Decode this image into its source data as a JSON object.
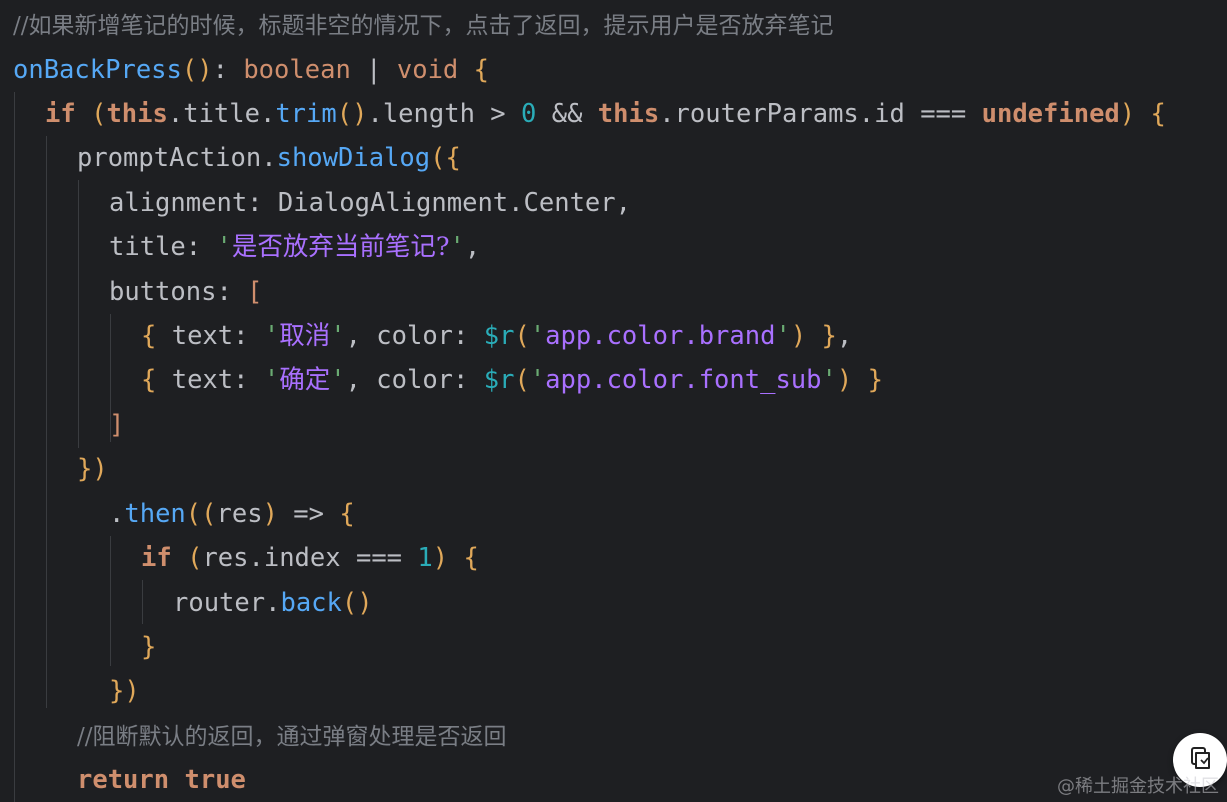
{
  "code": {
    "comment_top": "//如果新增笔记的时候，标题非空的情况下，点击了返回，提示用户是否放弃笔记",
    "l2": {
      "fn": "onBackPress",
      "paren": "()",
      "colon": ": ",
      "t1": "boolean",
      "pipe": " | ",
      "t2": "void",
      "brace": " {"
    },
    "l3": {
      "if": "if",
      "sp": " ",
      "op": "(",
      "this1": "this",
      "p1": ".title.",
      "trim": "trim",
      "call": "()",
      "p2": ".length > ",
      "zero": "0",
      "and": " && ",
      "this2": "this",
      "p3": ".routerParams.id === ",
      "undef": "undefined",
      "cp": ")",
      "ob": " {"
    },
    "l4": {
      "obj": "promptAction.",
      "fn": "showDialog",
      "op": "(",
      "ob": "{"
    },
    "l5": {
      "text": "alignment: DialogAlignment.Center,"
    },
    "l6": {
      "key": "title: ",
      "q1": "'",
      "val": "是否放弃当前笔记?",
      "q2": "'",
      "comma": ","
    },
    "l7": {
      "key": "buttons: ",
      "bracket": "["
    },
    "l8": {
      "ob": "{",
      "k1": " text: ",
      "q1": "'",
      "v1": "取消",
      "q2": "'",
      "c1": ", color: ",
      "dollar": "$r",
      "op": "(",
      "sq1": "'",
      "sv": "app.color.brand",
      "sq2": "'",
      "cp": ")",
      "cb": " }",
      "comma": ","
    },
    "l9": {
      "ob": "{",
      "k1": " text: ",
      "q1": "'",
      "v1": "确定",
      "q2": "'",
      "c1": ", color: ",
      "dollar": "$r",
      "op": "(",
      "sq1": "'",
      "sv": "app.color.font_sub",
      "sq2": "'",
      "cp": ")",
      "cb": " }"
    },
    "l10": {
      "bracket": "]"
    },
    "l11": {
      "cb": "}",
      "cp": ")"
    },
    "l12": {
      "dot": ".",
      "fn": "then",
      "op": "((",
      "param": "res",
      "cp": ")",
      "arrow": " => ",
      "ob": "{"
    },
    "l13": {
      "if": "if",
      "sp": " ",
      "op": "(",
      "expr": "res.index === ",
      "one": "1",
      "cp": ")",
      "ob": " {"
    },
    "l14": {
      "obj": "router.",
      "fn": "back",
      "call": "()"
    },
    "l15": {
      "cb": "}"
    },
    "l16": {
      "cb": "}",
      "cp": ")"
    },
    "comment_bottom": "//阻断默认的返回，通过弹窗处理是否返回",
    "l18": {
      "ret": "return",
      "sp": " ",
      "val": "true"
    }
  },
  "fab": {
    "icon": "copy-icon"
  },
  "watermark": "@稀土掘金技术社区",
  "colors": {
    "background": "#1e1f22",
    "keyword": "#cf8e6d",
    "function": "#56a8f5",
    "string": "#a970ff",
    "number": "#2aacb8",
    "comment": "#7a7e85"
  }
}
